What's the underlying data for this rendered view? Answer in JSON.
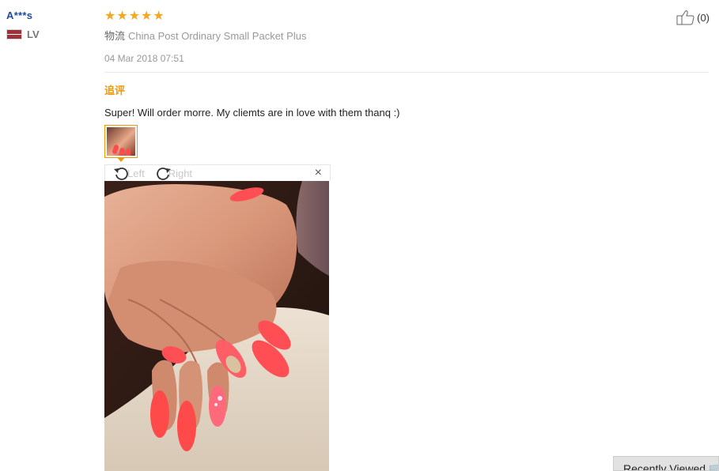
{
  "user": {
    "name": "A***s",
    "country_code": "LV"
  },
  "review": {
    "stars": 5,
    "logistics_label": "物流",
    "logistics_value": "China Post Ordinary Small Packet Plus",
    "date": "04 Mar 2018 07:51",
    "additional_label": "追评",
    "feedback": "Super! Will order morre. My cliemts are in love with them thanq :)"
  },
  "viewer": {
    "rotate_left_label": "Left",
    "rotate_right_label": "Right",
    "close_symbol": "×"
  },
  "helpful": {
    "count": "(0)"
  },
  "recently_viewed_label": "Recently Viewed 🛒",
  "colors": {
    "accent_orange": "#f39800",
    "star": "#f5a623",
    "username_blue": "#1a4ca1"
  },
  "icons": {
    "star": "star-icon",
    "thumbs_up": "thumbs-up-icon",
    "rotate_left": "rotate-left-icon",
    "rotate_right": "rotate-right-icon",
    "close": "close-icon",
    "flag": "latvia-flag-icon"
  }
}
